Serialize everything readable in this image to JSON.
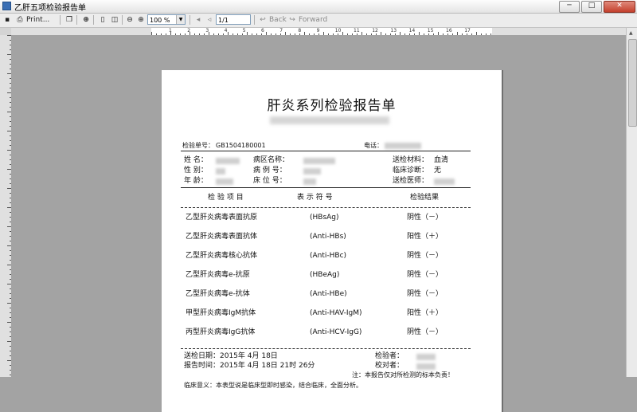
{
  "window": {
    "title": "乙肝五项检验报告单",
    "min": "─",
    "max": "□",
    "close": "✕"
  },
  "toolbar": {
    "print_label": "Print...",
    "zoom_value": "100 %",
    "page_value": "1/1",
    "back_label": "Back",
    "forward_label": "Forward",
    "back_glyph": "↩",
    "forward_glyph": "↪",
    "icons": [
      "print-icon",
      "copy-icon",
      "find-icon",
      "single-page-icon",
      "two-page-icon",
      "zoom-out-icon",
      "zoom-in-icon",
      "first-page-icon",
      "previous-page-icon"
    ]
  },
  "ruler_numbers": [
    "1",
    "2",
    "3",
    "4",
    "5",
    "6",
    "7",
    "8",
    "9",
    "10",
    "11",
    "12",
    "13",
    "14",
    "15",
    "16",
    "17"
  ],
  "report": {
    "title": "肝炎系列检验报告单",
    "sample_no_label": "检验单号：",
    "sample_no": "GB1504180001",
    "phone_label": "电话：",
    "name_label": "姓    名：",
    "sex_label": "性    别：",
    "age_label": "年    龄：",
    "ward_label": "病区名称：",
    "case_no_label": "病  例  号：",
    "bed_no_label": "床  位  号：",
    "material_label": "送检材料：",
    "material_value": "血清",
    "diagnosis_label": "临床诊断：",
    "diagnosis_value": "无",
    "doctor_label": "送检医师：",
    "header_item": "检 验 项 目",
    "header_symbol": "表 示 符 号",
    "header_result": "检验结果",
    "items": [
      {
        "name": "乙型肝炎病毒表面抗原",
        "symbol": "(HBsAg)",
        "result": "阴性（－）"
      },
      {
        "name": "乙型肝炎病毒表面抗体",
        "symbol": "(Anti-HBs)",
        "result": "阳性（＋）"
      },
      {
        "name": "乙型肝炎病毒核心抗体",
        "symbol": "(Anti-HBc)",
        "result": "阴性（－）"
      },
      {
        "name": "乙型肝炎病毒e-抗原",
        "symbol": "(HBeAg)",
        "result": "阴性（－）"
      },
      {
        "name": "乙型肝炎病毒e-抗体",
        "symbol": "(Anti-HBe)",
        "result": "阴性（－）"
      },
      {
        "name": "甲型肝炎病毒IgM抗体",
        "symbol": "(Anti-HAV-IgM)",
        "result": "阳性（＋）"
      },
      {
        "name": "丙型肝炎病毒IgG抗体",
        "symbol": "(Anti-HCV-IgG)",
        "result": "阴性（－）"
      }
    ],
    "send_date": "送检日期：2015年 4月 18日",
    "report_time": "报告时间：2015年 4月 18日  21时 26分",
    "inspector_label": "检验者：",
    "checker_label": "校对者：",
    "note": "注：本报告仅对所检测的标本负责！",
    "clinical": "临床意义：本表型说是临床型即时感染，结合临床，全面分析。"
  }
}
